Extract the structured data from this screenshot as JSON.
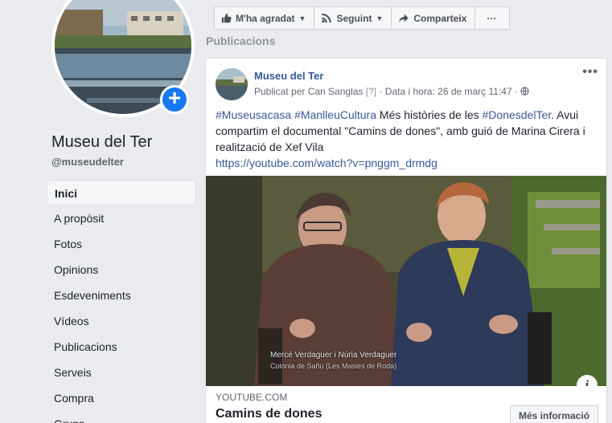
{
  "page": {
    "name": "Museu del Ter",
    "handle": "@museudelter"
  },
  "nav": {
    "items": [
      {
        "label": "Inici"
      },
      {
        "label": "A propòsit"
      },
      {
        "label": "Fotos"
      },
      {
        "label": "Opinions"
      },
      {
        "label": "Esdeveniments"
      },
      {
        "label": "Vídeos"
      },
      {
        "label": "Publicacions"
      },
      {
        "label": "Serveis"
      },
      {
        "label": "Compra"
      },
      {
        "label": "Grups"
      }
    ]
  },
  "actions": {
    "like_label": "M'ha agradat",
    "follow_label": "Seguint",
    "share_label": "Comparteix",
    "more_label": "···"
  },
  "section": {
    "title": "Publicacions"
  },
  "post": {
    "author": "Museu del Ter",
    "published_by": "Publicat per Can Sanglas",
    "help_marker": "[?]",
    "date": "· Data i hora: 26 de març 11:47 ·",
    "hashtag1": "#Museusacasa",
    "hashtag2": "#ManlleuCultura",
    "text_part1": " Més històries de les ",
    "hashtag3": "#DonesdelTer",
    "text_part2": ". Avui compartim el documental \"Camins de dones\", amb guió de Marina Cirera i realització de Xef Vila",
    "link": "https://youtube.com/watch?v=pnggm_drmdg",
    "video_caption1": "Mercè Verdaguer i Núria Verdaguer",
    "video_caption2": "Colònia de Sañú (Les Masies de Roda)",
    "info_label": "i",
    "source": "YOUTUBE.COM",
    "link_title": "Camins de dones",
    "more_info_label": "Més informació"
  },
  "colors": {
    "brand": "#1877f2",
    "link": "#385898",
    "background": "#e9ebee"
  }
}
